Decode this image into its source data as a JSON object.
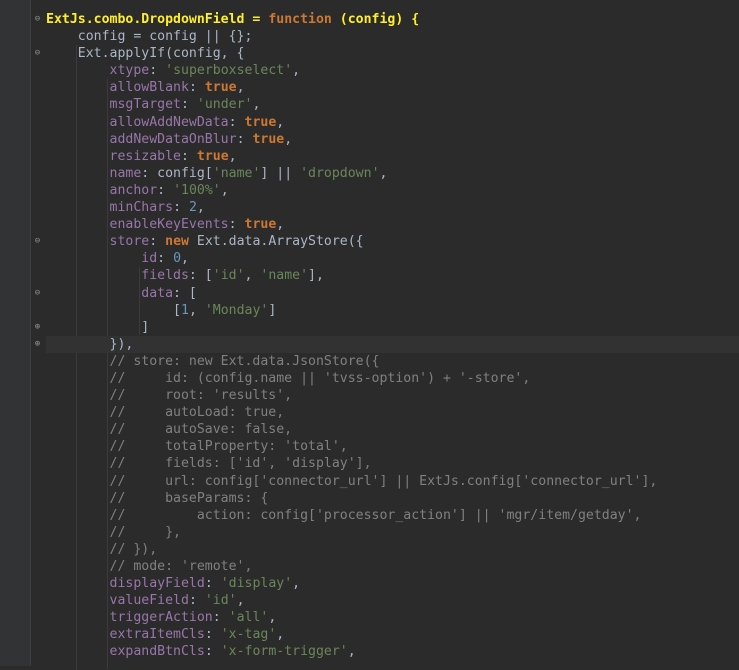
{
  "editor": {
    "lines": [
      "ExtJs.combo.DropdownField = function (config) {",
      "    config = config || {};",
      "    Ext.applyIf(config, {",
      "        xtype: 'superboxselect',",
      "        allowBlank: true,",
      "        msgTarget: 'under',",
      "        allowAddNewData: true,",
      "        addNewDataOnBlur: true,",
      "        resizable: true,",
      "        name: config['name'] || 'dropdown',",
      "        anchor: '100%',",
      "        minChars: 2,",
      "        enableKeyEvents: true,",
      "        store: new Ext.data.ArrayStore({",
      "            id: 0,",
      "            fields: ['id', 'name'],",
      "            data: [",
      "                [1, 'Monday']",
      "            ]",
      "        }),",
      "        // store: new Ext.data.JsonStore({",
      "        //     id: (config.name || 'tvss-option') + '-store',",
      "        //     root: 'results',",
      "        //     autoLoad: true,",
      "        //     autoSave: false,",
      "        //     totalProperty: 'total',",
      "        //     fields: ['id', 'display'],",
      "        //     url: config['connector_url'] || ExtJs.config['connector_url'],",
      "        //     baseParams: {",
      "        //         action: config['processor_action'] || 'mgr/item/getday',",
      "        //     },",
      "        // }),",
      "        // mode: 'remote',",
      "        displayField: 'display',",
      "        valueField: 'id',",
      "        triggerAction: 'all',",
      "        extraItemCls: 'x-tag',",
      "        expandBtnCls: 'x-form-trigger',"
    ]
  },
  "colors": {
    "background": "#2b2b2b",
    "gutter": "#313335",
    "keyword": "#cc7832",
    "string": "#6a8759",
    "number": "#6897bb",
    "comment": "#808080",
    "text": "#a9b7c6"
  }
}
